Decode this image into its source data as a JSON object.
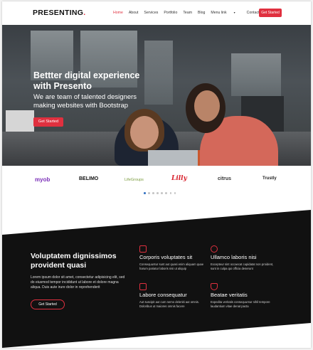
{
  "header": {
    "logo": "PRESENTING",
    "logo_dot": ".",
    "nav": [
      "Home",
      "About",
      "Services",
      "Portfolio",
      "Team",
      "Blog",
      "Menu link",
      "Contact"
    ],
    "nav_cta": "Get Started"
  },
  "hero": {
    "title": "Bettter digital experience with Presento",
    "subtitle": "We are team of talented designers making websites with Bootstrap",
    "cta": "Get Started"
  },
  "clients": {
    "logos": [
      "myob",
      "BELIMO",
      "LifeGroups",
      "Lilly",
      "citrus",
      "Trustly"
    ],
    "carousel_pages": 8,
    "active_page": 1
  },
  "about": {
    "title": "Voluptatem dignissimos provident quasi",
    "text": "Lorem ipsum dolor sit amet, consectetur adipisicing elit, sed do eiusmod tempor incididunt ut labore et dolore magna aliqua. Duis aute irure dolor in reprehenderit",
    "cta": "Get Started",
    "features": [
      {
        "icon": "receipt-icon",
        "title": "Corporis voluptates sit",
        "text": "Consequuntur sunt aut quasi enim aliquam quae harum pariatur laboris nisi ut aliquip"
      },
      {
        "icon": "cube-icon",
        "title": "Ullamco laboris nisi",
        "text": "Excepteur sint occaecat cupidatat non proident, sunt in culpa qui officia deserunt"
      },
      {
        "icon": "images-icon",
        "title": "Labore consequatur",
        "text": "Aut suscipit aut cum nemo deleniti aut omnis. Doloribus ut maiores omnis facere"
      },
      {
        "icon": "shield-icon",
        "title": "Beatae veritatis",
        "text": "Expedita veritatis consequuntur nihil tempore laudantium vitae denat pacta"
      }
    ]
  },
  "colors": {
    "accent": "#e0303f",
    "dark": "#111111",
    "carousel_active": "#3a76c4"
  }
}
